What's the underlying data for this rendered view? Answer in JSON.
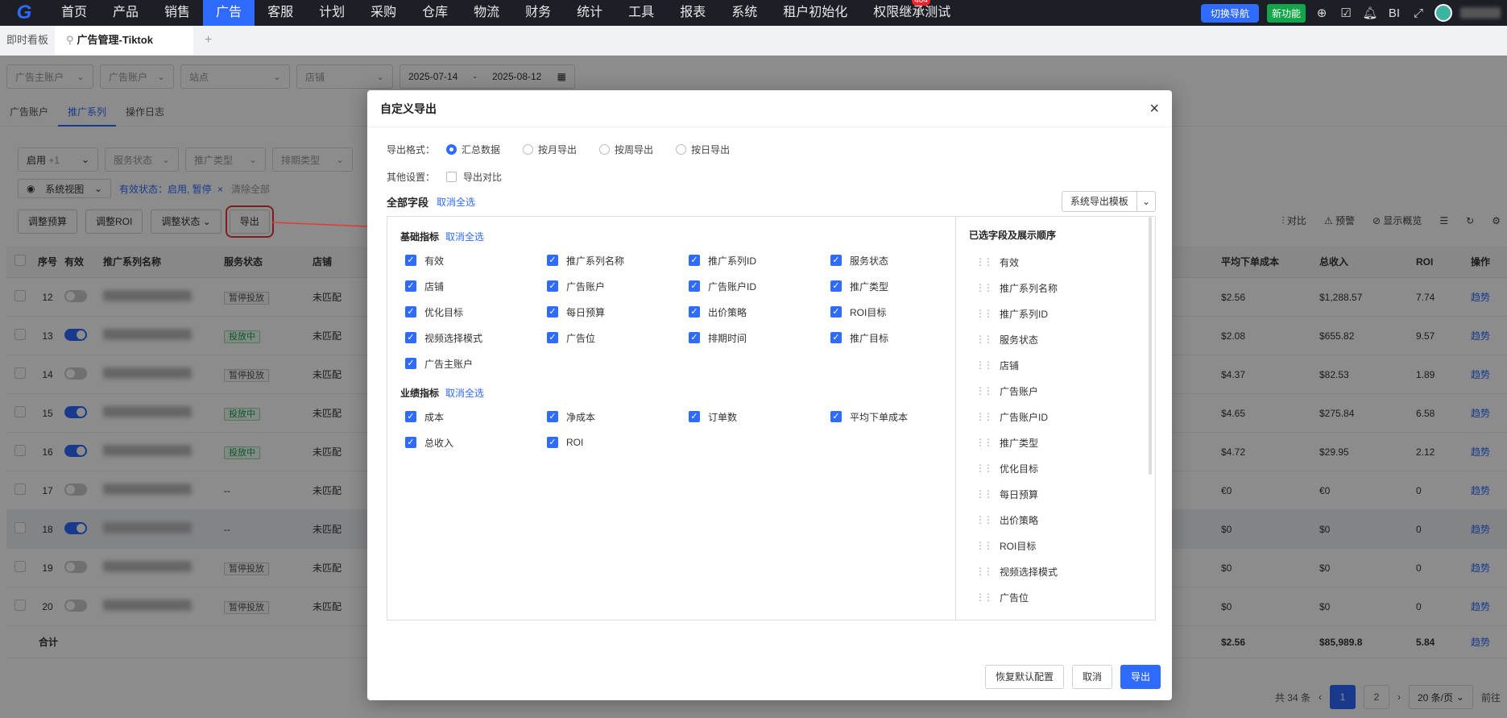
{
  "nav": {
    "logo": "G",
    "items": [
      "首页",
      "产品",
      "销售",
      "广告",
      "客服",
      "计划",
      "采购",
      "仓库",
      "物流",
      "财务",
      "统计",
      "工具",
      "报表",
      "系统",
      "租户初始化",
      "权限继承测试"
    ],
    "active_index": 3,
    "badge": "404",
    "switch_label": "切换导航",
    "new_label": "新功能",
    "bi_label": "BI"
  },
  "tabs": {
    "dashboard": "即时看板",
    "active": "广告管理-Tiktok",
    "add": "+"
  },
  "filters": {
    "advertiser": "广告主账户",
    "ad_account": "广告账户",
    "site": "站点",
    "store": "店铺",
    "date_start": "2025-07-14",
    "date_sep": "-",
    "date_end": "2025-08-12"
  },
  "subtabs": [
    "广告账户",
    "推广系列",
    "操作日志"
  ],
  "filter2": {
    "status": "启用",
    "status_more": "+1",
    "service": "服务状态",
    "promo_type": "推广类型",
    "schedule_type": "排期类型"
  },
  "chips": {
    "view": "系统视图",
    "active_status": "有效状态：启用, 暂停",
    "clear": "清除全部"
  },
  "actions": {
    "budget": "调整预算",
    "roi": "调整ROI",
    "status": "调整状态",
    "export": "导出"
  },
  "tools": {
    "compare": "对比",
    "alert": "预警",
    "overview": "显示概览"
  },
  "table": {
    "headers": {
      "no": "序号",
      "valid": "有效",
      "name": "推广系列名称",
      "service": "服务状态",
      "store": "店铺",
      "avg_cost": "平均下单成本",
      "revenue": "总收入",
      "roi": "ROI",
      "op": "操作"
    },
    "rows": [
      {
        "no": "12",
        "on": false,
        "status": "暂停投放",
        "store": "未匹配",
        "avg": "$2.56",
        "rev": "$1,288.57",
        "roi": "7.74",
        "op": "趋势"
      },
      {
        "no": "13",
        "on": true,
        "status": "投放中",
        "store": "未匹配",
        "avg": "$2.08",
        "rev": "$655.82",
        "roi": "9.57",
        "op": "趋势"
      },
      {
        "no": "14",
        "on": false,
        "status": "暂停投放",
        "store": "未匹配",
        "avg": "$4.37",
        "rev": "$82.53",
        "roi": "1.89",
        "op": "趋势"
      },
      {
        "no": "15",
        "on": true,
        "status": "投放中",
        "store": "未匹配",
        "avg": "$4.65",
        "rev": "$275.84",
        "roi": "6.58",
        "op": "趋势"
      },
      {
        "no": "16",
        "on": true,
        "status": "投放中",
        "store": "未匹配",
        "avg": "$4.72",
        "rev": "$29.95",
        "roi": "2.12",
        "op": "趋势"
      },
      {
        "no": "17",
        "on": false,
        "status": "--",
        "store": "未匹配",
        "avg": "€0",
        "rev": "€0",
        "roi": "0",
        "op": "趋势"
      },
      {
        "no": "18",
        "on": true,
        "status": "--",
        "store": "未匹配",
        "avg": "$0",
        "rev": "$0",
        "roi": "0",
        "op": "趋势"
      },
      {
        "no": "19",
        "on": false,
        "status": "暂停投放",
        "store": "未匹配",
        "avg": "$0",
        "rev": "$0",
        "roi": "0",
        "op": "趋势"
      },
      {
        "no": "20",
        "on": false,
        "status": "暂停投放",
        "store": "未匹配",
        "avg": "$0",
        "rev": "$0",
        "roi": "0",
        "op": "趋势"
      }
    ],
    "total": {
      "label": "合计",
      "avg": "$2.56",
      "rev": "$85,989.8",
      "roi": "5.84",
      "op": "趋势"
    }
  },
  "pager": {
    "total": "共 34 条",
    "prev": "‹",
    "pages": [
      "1",
      "2"
    ],
    "next": "›",
    "size": "20 条/页",
    "goto": "前往"
  },
  "modal": {
    "title": "自定义导出",
    "close": "×",
    "format_label": "导出格式：",
    "formats": [
      "汇总数据",
      "按月导出",
      "按周导出",
      "按日导出"
    ],
    "format_selected": 0,
    "other_label": "其他设置：",
    "compare_label": "导出对比",
    "all_fields": "全部字段",
    "deselect_all": "取消全选",
    "template": "系统导出模板",
    "basic_group": "基础指标",
    "basic_deselect": "取消全选",
    "basic_fields": [
      "有效",
      "推广系列名称",
      "推广系列ID",
      "服务状态",
      "店铺",
      "广告账户",
      "广告账户ID",
      "推广类型",
      "优化目标",
      "每日预算",
      "出价策略",
      "ROI目标",
      "视频选择模式",
      "广告位",
      "排期时间",
      "推广目标",
      "广告主账户"
    ],
    "perf_group": "业绩指标",
    "perf_deselect": "取消全选",
    "perf_fields": [
      "成本",
      "净成本",
      "订单数",
      "平均下单成本",
      "总收入",
      "ROI"
    ],
    "selected_title": "已选字段及展示顺序",
    "selected_fields": [
      "有效",
      "推广系列名称",
      "推广系列ID",
      "服务状态",
      "店铺",
      "广告账户",
      "广告账户ID",
      "推广类型",
      "优化目标",
      "每日预算",
      "出价策略",
      "ROI目标",
      "视频选择模式",
      "广告位"
    ],
    "restore": "恢复默认配置",
    "cancel": "取消",
    "export": "导出"
  },
  "colors": {
    "primary": "#2f6bff",
    "nav_bg": "#1c1f26",
    "highlight": "#e53935",
    "success": "#13a54a"
  }
}
